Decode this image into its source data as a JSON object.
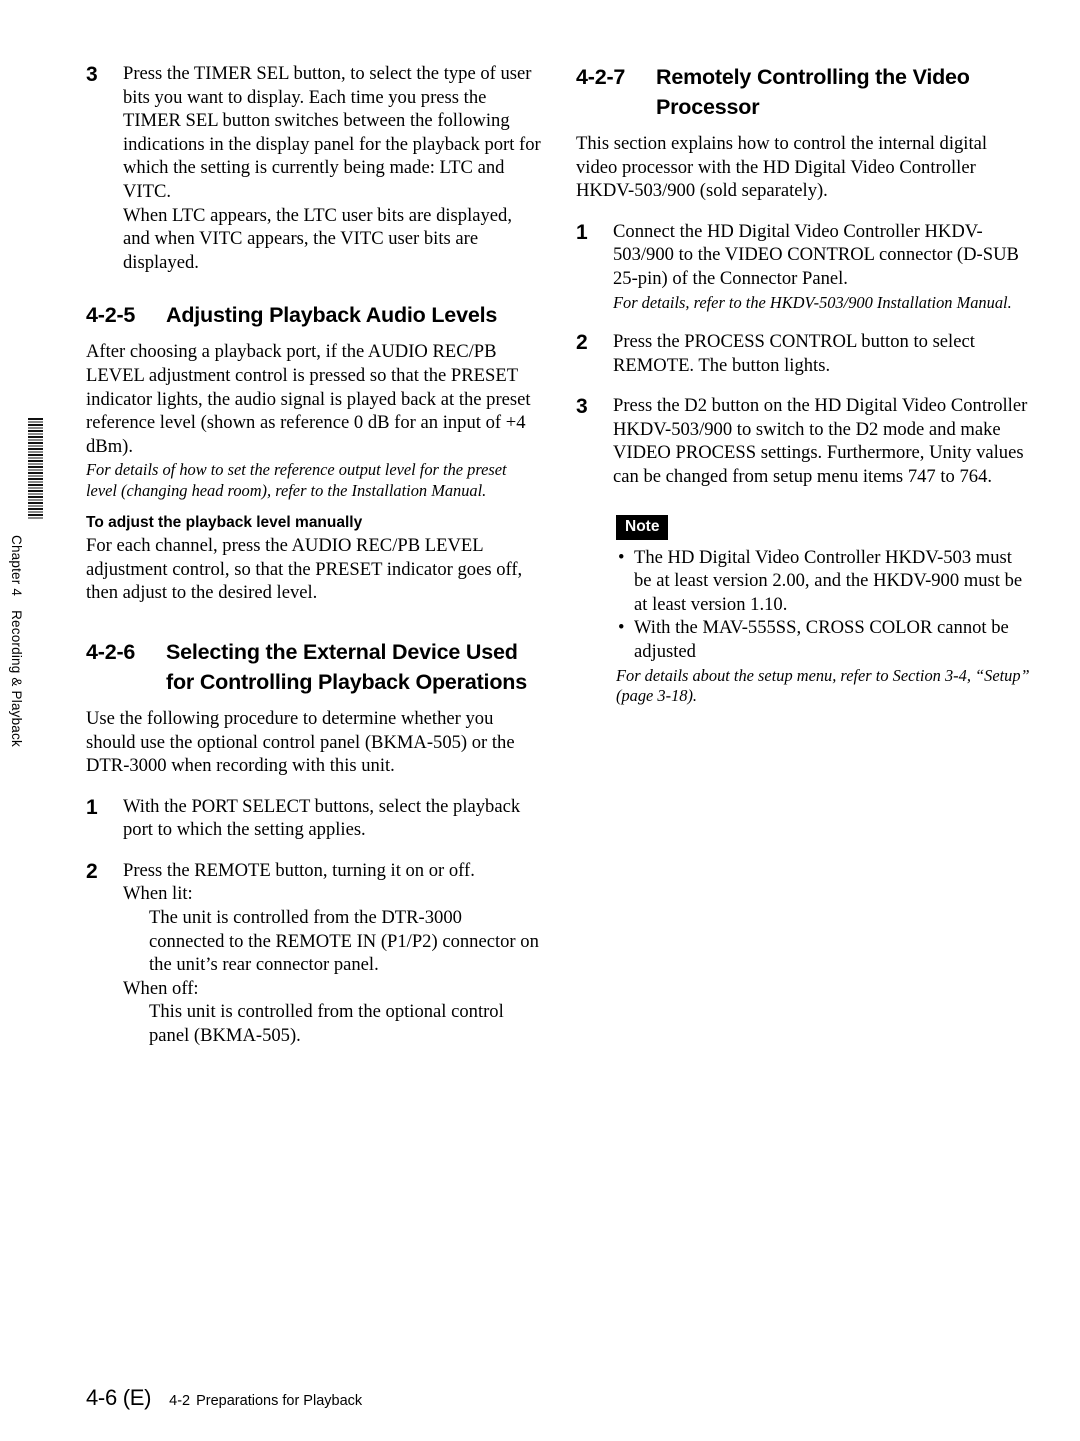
{
  "margin_tab": {
    "chapter": "Chapter 4",
    "title": "Recording & Playback"
  },
  "left_column": {
    "step3": {
      "number": "3",
      "text": "Press the TIMER SEL button, to select the type of user bits you want to display. Each time you press the TIMER SEL button switches between the following indications in the display panel for the playback port for which the setting is currently being made: LTC and VITC.",
      "text2": "When LTC appears, the LTC user bits are displayed, and when VITC appears, the VITC user bits are displayed."
    },
    "section_425": {
      "number": "4-2-5",
      "title": "Adjusting Playback Audio Levels",
      "paragraph": "After choosing a playback port, if the AUDIO REC/PB LEVEL adjustment control is pressed so that the PRESET indicator lights, the audio signal is played back at the preset reference level (shown as reference 0 dB for an input of +4 dBm).",
      "italic_note": "For details of how to set the reference output level for the preset level (changing head room), refer to the Installation Manual.",
      "subheading": "To adjust the playback level manually",
      "sub_paragraph": "For each channel, press the AUDIO REC/PB LEVEL adjustment control, so that the PRESET indicator goes off, then adjust to the desired level."
    },
    "section_426": {
      "number": "4-2-6",
      "title": "Selecting the External Device Used for Controlling Playback Operations",
      "paragraph": "Use the following procedure to determine whether you should use the optional control panel (BKMA-505) or the DTR-3000 when recording with this unit.",
      "steps": [
        {
          "number": "1",
          "text": "With the PORT SELECT buttons, select the playback port to which the setting applies."
        },
        {
          "number": "2",
          "text": "Press the REMOTE button, turning it on or off.",
          "line_when_lit": "When lit:",
          "when_lit_body": "The unit is controlled from the DTR-3000 connected to the REMOTE IN (P1/P2) connector on the unit’s rear connector panel.",
          "line_when_off": "When off:",
          "when_off_body": "This unit is controlled from the optional control panel (BKMA-505)."
        }
      ]
    }
  },
  "right_column": {
    "section_427": {
      "number": "4-2-7",
      "title": "Remotely Controlling the Video Processor",
      "paragraph": "This section explains how to control the internal digital video processor with the HD Digital Video Controller HKDV-503/900 (sold separately).",
      "steps": [
        {
          "number": "1",
          "text": "Connect the HD Digital Video Controller HKDV-503/900 to the VIDEO CONTROL connector (D-SUB 25-pin) of the Connector Panel.",
          "italic_note": "For details, refer to the HKDV-503/900 Installation Manual."
        },
        {
          "number": "2",
          "text": "Press the PROCESS CONTROL button to select REMOTE. The button lights."
        },
        {
          "number": "3",
          "text": "Press the D2 button on the HD Digital Video Controller HKDV-503/900 to switch to the D2 mode and make VIDEO PROCESS settings. Furthermore, Unity values can be changed from setup menu items 747 to 764."
        }
      ],
      "note": {
        "badge": "Note",
        "bullet_char": "•",
        "items": [
          "The HD Digital Video Controller HKDV-503 must be at least version 2.00, and the HKDV-900 must be at least version 1.10.",
          "With the MAV-555SS, CROSS COLOR cannot be adjusted"
        ],
        "italic_note": "For details about the setup menu, refer to Section 3-4, “Setup” (page 3-18)."
      }
    }
  },
  "footer": {
    "page_number": "4-6 (E)",
    "section_number": "4-2",
    "section_title": "Preparations for Playback"
  }
}
